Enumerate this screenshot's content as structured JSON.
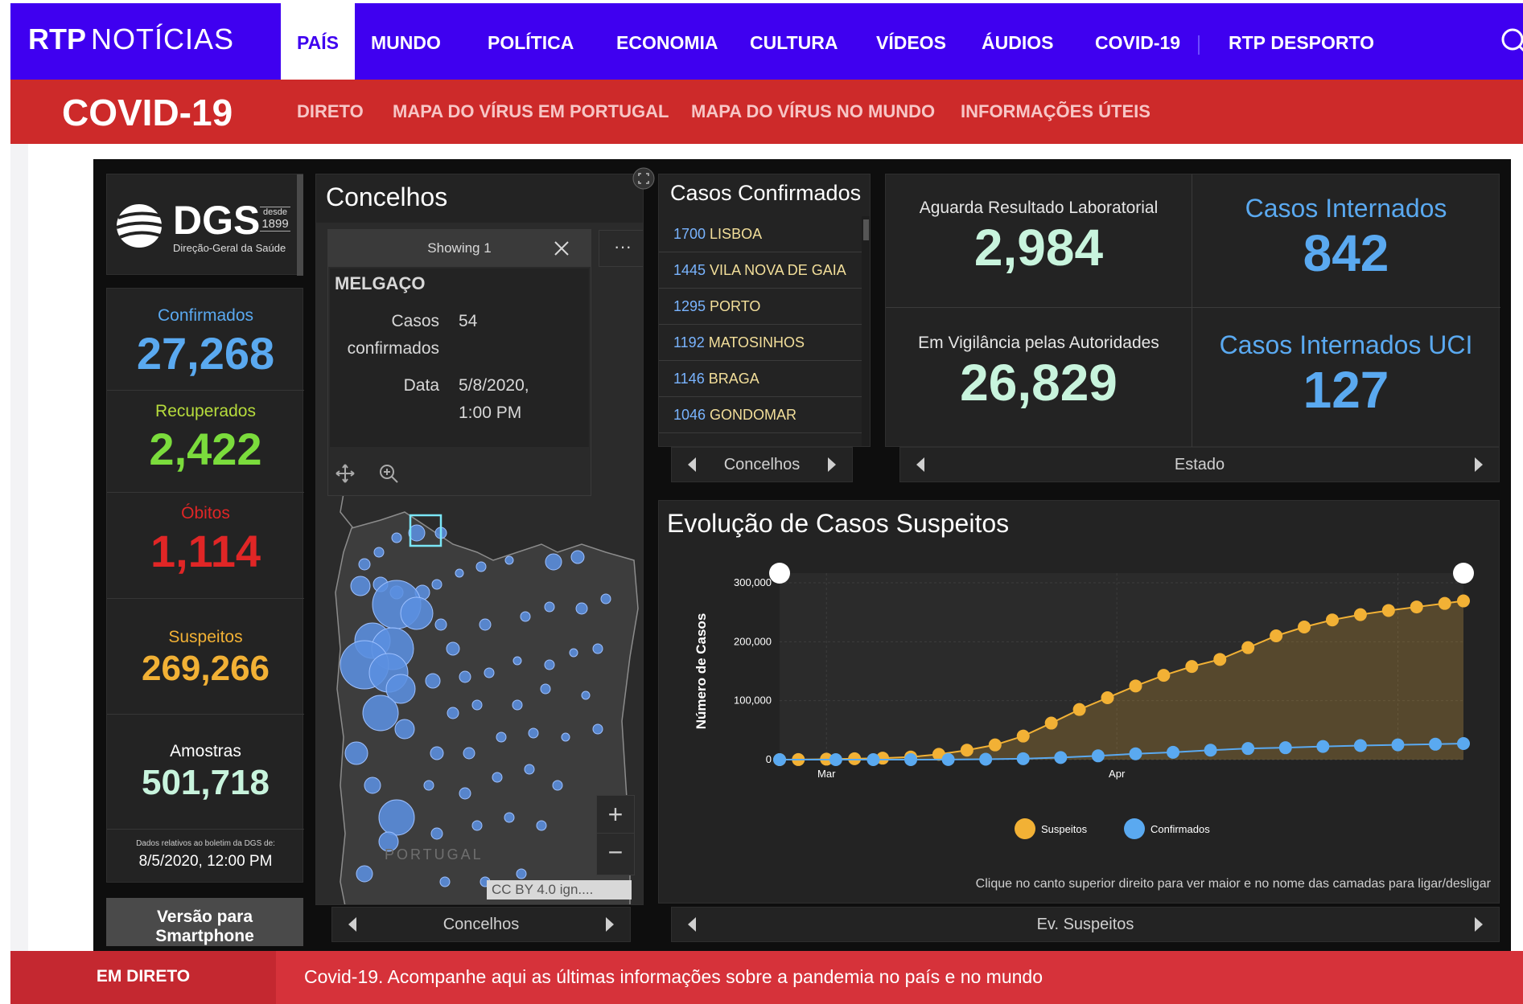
{
  "header": {
    "logo_rtp": "RTP",
    "logo_noticias": "NOTÍCIAS",
    "nav": [
      "PAÍS",
      "MUNDO",
      "POLÍTICA",
      "ECONOMIA",
      "CULTURA",
      "VÍDEOS",
      "ÁUDIOS",
      "COVID-19"
    ],
    "desporto_rtp": "RTP",
    "desporto_label": "DESPORTO",
    "active": "PAÍS"
  },
  "covid_bar": {
    "title": "COVID-19",
    "links": [
      "DIRETO",
      "MAPA DO VÍRUS EM PORTUGAL",
      "MAPA DO VÍRUS NO MUNDO",
      "INFORMAÇÕES ÚTEIS"
    ]
  },
  "dgs": {
    "name": "DGS",
    "since_top": "desde",
    "since_year": "1899",
    "subtitle": "Direção-Geral da Saúde"
  },
  "stats": {
    "confirmados_label": "Confirmados",
    "confirmados_value": "27,268",
    "recuperados_label": "Recuperados",
    "recuperados_value": "2,422",
    "obitos_label": "Óbitos",
    "obitos_value": "1,114",
    "suspeitos_label": "Suspeitos",
    "suspeitos_value": "269,266",
    "amostras_label": "Amostras",
    "amostras_value": "501,718",
    "note": "Dados relativos ao boletim da DGS de:",
    "note_date": "8/5/2020, 12:00 PM",
    "smartphone": "Versão para Smartphone"
  },
  "map": {
    "title": "Concelhos",
    "popup_header": "Showing 1",
    "popup_more": "···",
    "popup_name": "MELGAÇO",
    "field1_label_a": "Casos",
    "field1_label_b": "confirmados",
    "field1_value": "54",
    "field2_label": "Data",
    "field2_value_a": "5/8/2020,",
    "field2_value_b": "1:00 PM",
    "country_label": "PORTUGAL",
    "attribution": "CC BY 4.0 ign....",
    "footer": "Concelhos"
  },
  "cases": {
    "title": "Casos Confirmados",
    "rows": [
      {
        "n": "1700",
        "c": "LISBOA"
      },
      {
        "n": "1445",
        "c": "VILA NOVA DE GAIA"
      },
      {
        "n": "1295",
        "c": "PORTO"
      },
      {
        "n": "1192",
        "c": "MATOSINHOS"
      },
      {
        "n": "1146",
        "c": "BRAGA"
      },
      {
        "n": "1046",
        "c": "GONDOMAR"
      }
    ],
    "footer": "Concelhos"
  },
  "kpis": {
    "aguarda_label": "Aguarda Resultado Laboratorial",
    "aguarda_value": "2,984",
    "internados_label": "Casos Internados",
    "internados_value": "842",
    "vigilancia_label": "Em Vigilância pelas Autoridades",
    "vigilancia_value": "26,829",
    "uci_label": "Casos Internados UCI",
    "uci_value": "127",
    "footer": "Estado"
  },
  "chart": {
    "title": "Evolução de Casos Suspeitos",
    "note": "Clique no canto superior direito para ver maior e no nome das camadas para ligar/desligar",
    "footer": "Ev. Suspeitos"
  },
  "chart_data": {
    "type": "line",
    "title": "Evolução de Casos Suspeitos",
    "ylabel": "Número de Casos",
    "xlabel": "",
    "ylim": [
      0,
      300000
    ],
    "yticks": [
      "0",
      "100,000",
      "200,000",
      "300,000"
    ],
    "xticks": [
      "Mar",
      "Apr"
    ],
    "legend_position": "bottom",
    "series": [
      {
        "name": "Suspeitos",
        "color": "#f2b135",
        "x": [
          "2020-02-25",
          "2020-02-27",
          "2020-03-01",
          "2020-03-04",
          "2020-03-07",
          "2020-03-10",
          "2020-03-13",
          "2020-03-16",
          "2020-03-19",
          "2020-03-22",
          "2020-03-25",
          "2020-03-28",
          "2020-03-31",
          "2020-04-03",
          "2020-04-06",
          "2020-04-09",
          "2020-04-12",
          "2020-04-15",
          "2020-04-18",
          "2020-04-21",
          "2020-04-24",
          "2020-04-27",
          "2020-04-30",
          "2020-05-03",
          "2020-05-06",
          "2020-05-08"
        ],
        "values": [
          25,
          100,
          800,
          1500,
          2500,
          4500,
          9000,
          16000,
          25000,
          40000,
          62000,
          85000,
          105000,
          125000,
          143000,
          158000,
          170000,
          190000,
          210000,
          225000,
          237000,
          246000,
          253000,
          259000,
          265000,
          269266
        ]
      },
      {
        "name": "Confirmados",
        "color": "#5aa9f0",
        "x": [
          "2020-02-25",
          "2020-03-02",
          "2020-03-06",
          "2020-03-10",
          "2020-03-14",
          "2020-03-18",
          "2020-03-22",
          "2020-03-26",
          "2020-03-30",
          "2020-04-03",
          "2020-04-07",
          "2020-04-11",
          "2020-04-15",
          "2020-04-19",
          "2020-04-23",
          "2020-04-27",
          "2020-05-01",
          "2020-05-05",
          "2020-05-08"
        ],
        "values": [
          0,
          2,
          13,
          41,
          169,
          642,
          1600,
          3544,
          6408,
          9886,
          12442,
          15987,
          18841,
          20206,
          22353,
          23864,
          25045,
          26182,
          27268
        ]
      }
    ]
  },
  "bottom": {
    "em_direto": "EM DIRETO",
    "ticker": "Covid-19. Acompanhe aqui as últimas informações sobre a pandemia no país e no mundo"
  },
  "colors": {
    "header_blue": "#3f00f0",
    "covid_red": "#cd2a2a",
    "confirmados": "#5aa9f0",
    "recuperados": "#7bdc3c",
    "obitos": "#e02626",
    "suspeitos": "#f2b135",
    "amostras": "#c8f4dd"
  }
}
